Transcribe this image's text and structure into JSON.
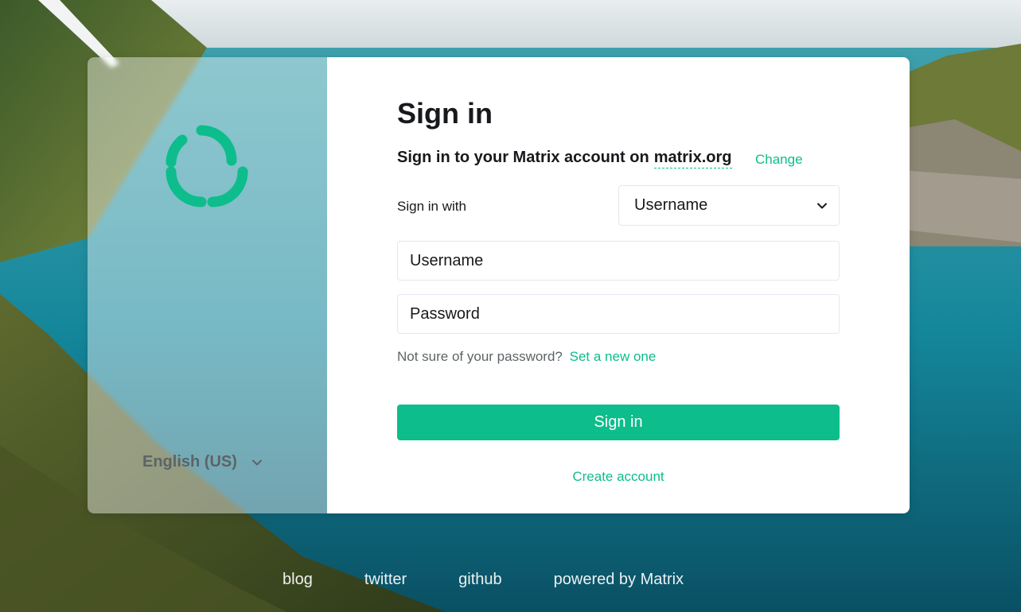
{
  "login": {
    "title": "Sign in",
    "subtitle_prefix": "Sign in to your Matrix account on",
    "server": "matrix.org",
    "change_label": "Change",
    "sign_in_with_label": "Sign in with",
    "login_type_selected": "Username",
    "username_placeholder": "Username",
    "password_placeholder": "Password",
    "forgot_prefix": "Not sure of your password?",
    "forgot_link": "Set a new one",
    "submit_label": "Sign in",
    "create_account_label": "Create account"
  },
  "language": {
    "selected": "English (US)"
  },
  "footer": {
    "links": [
      "blog",
      "twitter",
      "github",
      "powered by Matrix"
    ]
  },
  "icons": {
    "logo": "element-logo",
    "language_chevron": "chevron-down-icon",
    "select_chevron": "chevron-down-icon"
  },
  "colors": {
    "accent": "#0dbd8b",
    "text": "#17191c",
    "secondary_text": "#5d6466",
    "annotation": "#e0141e"
  }
}
